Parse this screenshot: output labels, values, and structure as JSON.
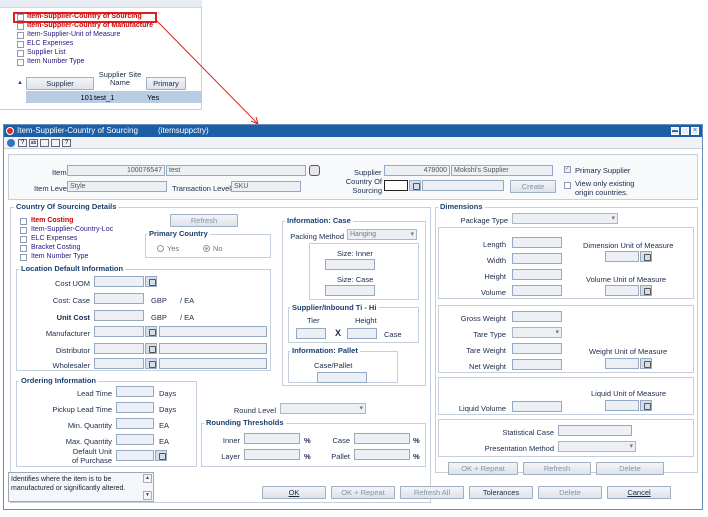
{
  "top_panel": {
    "links": [
      {
        "label": "Item-Supplier-Country of Sourcing",
        "style": "red"
      },
      {
        "label": "Item-Supplier-Country of Manufacture",
        "style": "red"
      },
      {
        "label": "Item-Supplier-Unit of Measure",
        "style": "blue"
      },
      {
        "label": "ELC Expenses",
        "style": "blue"
      },
      {
        "label": "Supplier List",
        "style": "blue"
      },
      {
        "label": "Item Number Type",
        "style": "blue"
      }
    ],
    "table": {
      "headers": [
        "Supplier",
        "Supplier Site Name",
        "Primary"
      ],
      "row": {
        "supplier": "101",
        "site": "test_1",
        "primary": "Yes"
      }
    }
  },
  "window": {
    "title": "Item-Supplier-Country of Sourcing",
    "code": "(itemsuppctry)",
    "title_color": "#1c5fa6"
  },
  "header": {
    "item_label": "Item",
    "item_number": "100076547",
    "item_desc": "test",
    "item_level_label": "Item Level",
    "item_level": "Style",
    "transaction_level_label": "Transaction Level",
    "transaction_level": "SKU",
    "supplier_label": "Supplier",
    "supplier_number": "478000",
    "supplier_name": "Mokshi's Supplier",
    "country_label_1": "Country Of",
    "country_label_2": "Sourcing",
    "create_button": "Create",
    "primary_supplier": "Primary Supplier",
    "view_only_1": "View only existing",
    "view_only_2": "origin countries."
  },
  "cos_details": {
    "title": "Country Of Sourcing Details",
    "links": [
      {
        "label": "Item Costing",
        "style": "red"
      },
      {
        "label": "Item-Supplier-Country-Loc",
        "style": "blue"
      },
      {
        "label": "ELC Expenses",
        "style": "blue"
      },
      {
        "label": "Bracket Costing",
        "style": "blue"
      },
      {
        "label": "Item Number Type",
        "style": "blue"
      }
    ],
    "refresh_button": "Refresh",
    "primary_country": {
      "title": "Primary Country",
      "yes": "Yes",
      "no": "No"
    }
  },
  "location_default": {
    "title": "Location Default Information",
    "cost_uom": "Cost UOM",
    "cost_case": "Cost: Case",
    "cost_case_currency": "GBP",
    "cost_case_per": "/ EA",
    "unit_cost": "Unit Cost",
    "unit_cost_currency": "GBP",
    "unit_cost_per": "/ EA",
    "manufacturer": "Manufacturer",
    "distributor": "Distributor",
    "wholesaler": "Wholesaler"
  },
  "ordering": {
    "title": "Ordering Information",
    "lead_time": "Lead Time",
    "lead_time_unit": "Days",
    "pickup_lead_time": "Pickup Lead Time",
    "pickup_unit": "Days",
    "min_qty": "Min. Quantity",
    "min_unit": "EA",
    "max_qty": "Max. Quantity",
    "max_unit": "EA",
    "default_unit_1": "Default Unit",
    "default_unit_2": "of Purchase"
  },
  "info_case": {
    "title": "Information: Case",
    "packing_method": "Packing Method",
    "packing_value": "Hanging",
    "size_inner": "Size: Inner",
    "size_case": "Size: Case"
  },
  "ti_hi": {
    "title": "Supplier/Inbound Ti - Hi",
    "tier": "Tier",
    "height": "Height",
    "x": "X",
    "case": "Case"
  },
  "info_pallet": {
    "title": "Information: Pallet",
    "case_pallet": "Case/Pallet"
  },
  "round_level": "Round Level",
  "rounding": {
    "title": "Rounding Thresholds",
    "inner": "Inner",
    "case": "Case",
    "layer": "Layer",
    "pallet": "Pallet",
    "pct": "%"
  },
  "dimensions": {
    "title": "Dimensions",
    "package_type": "Package Type",
    "length": "Length",
    "width": "Width",
    "height": "Height",
    "volume": "Volume",
    "dim_uom": "Dimension Unit of Measure",
    "vol_uom": "Volume Unit of Measure",
    "gross_weight": "Gross Weight",
    "tare_type": "Tare Type",
    "tare_weight": "Tare Weight",
    "net_weight": "Net Weight",
    "weight_uom": "Weight Unit of Measure",
    "liquid_uom": "Liquid Unit of Measure",
    "liquid_volume": "Liquid Volume",
    "statistical_case": "Statistical Case",
    "presentation_method": "Presentation Method",
    "ok_repeat": "OK + Repeat",
    "refresh": "Refresh",
    "delete": "Delete"
  },
  "hint": "Identifies where the item is to be manufactured or significantly altered.",
  "footer": {
    "ok": "OK",
    "ok_repeat": "OK + Repeat",
    "refresh_all": "Refresh All",
    "tolerances": "Tolerances",
    "delete": "Delete",
    "cancel": "Cancel"
  }
}
